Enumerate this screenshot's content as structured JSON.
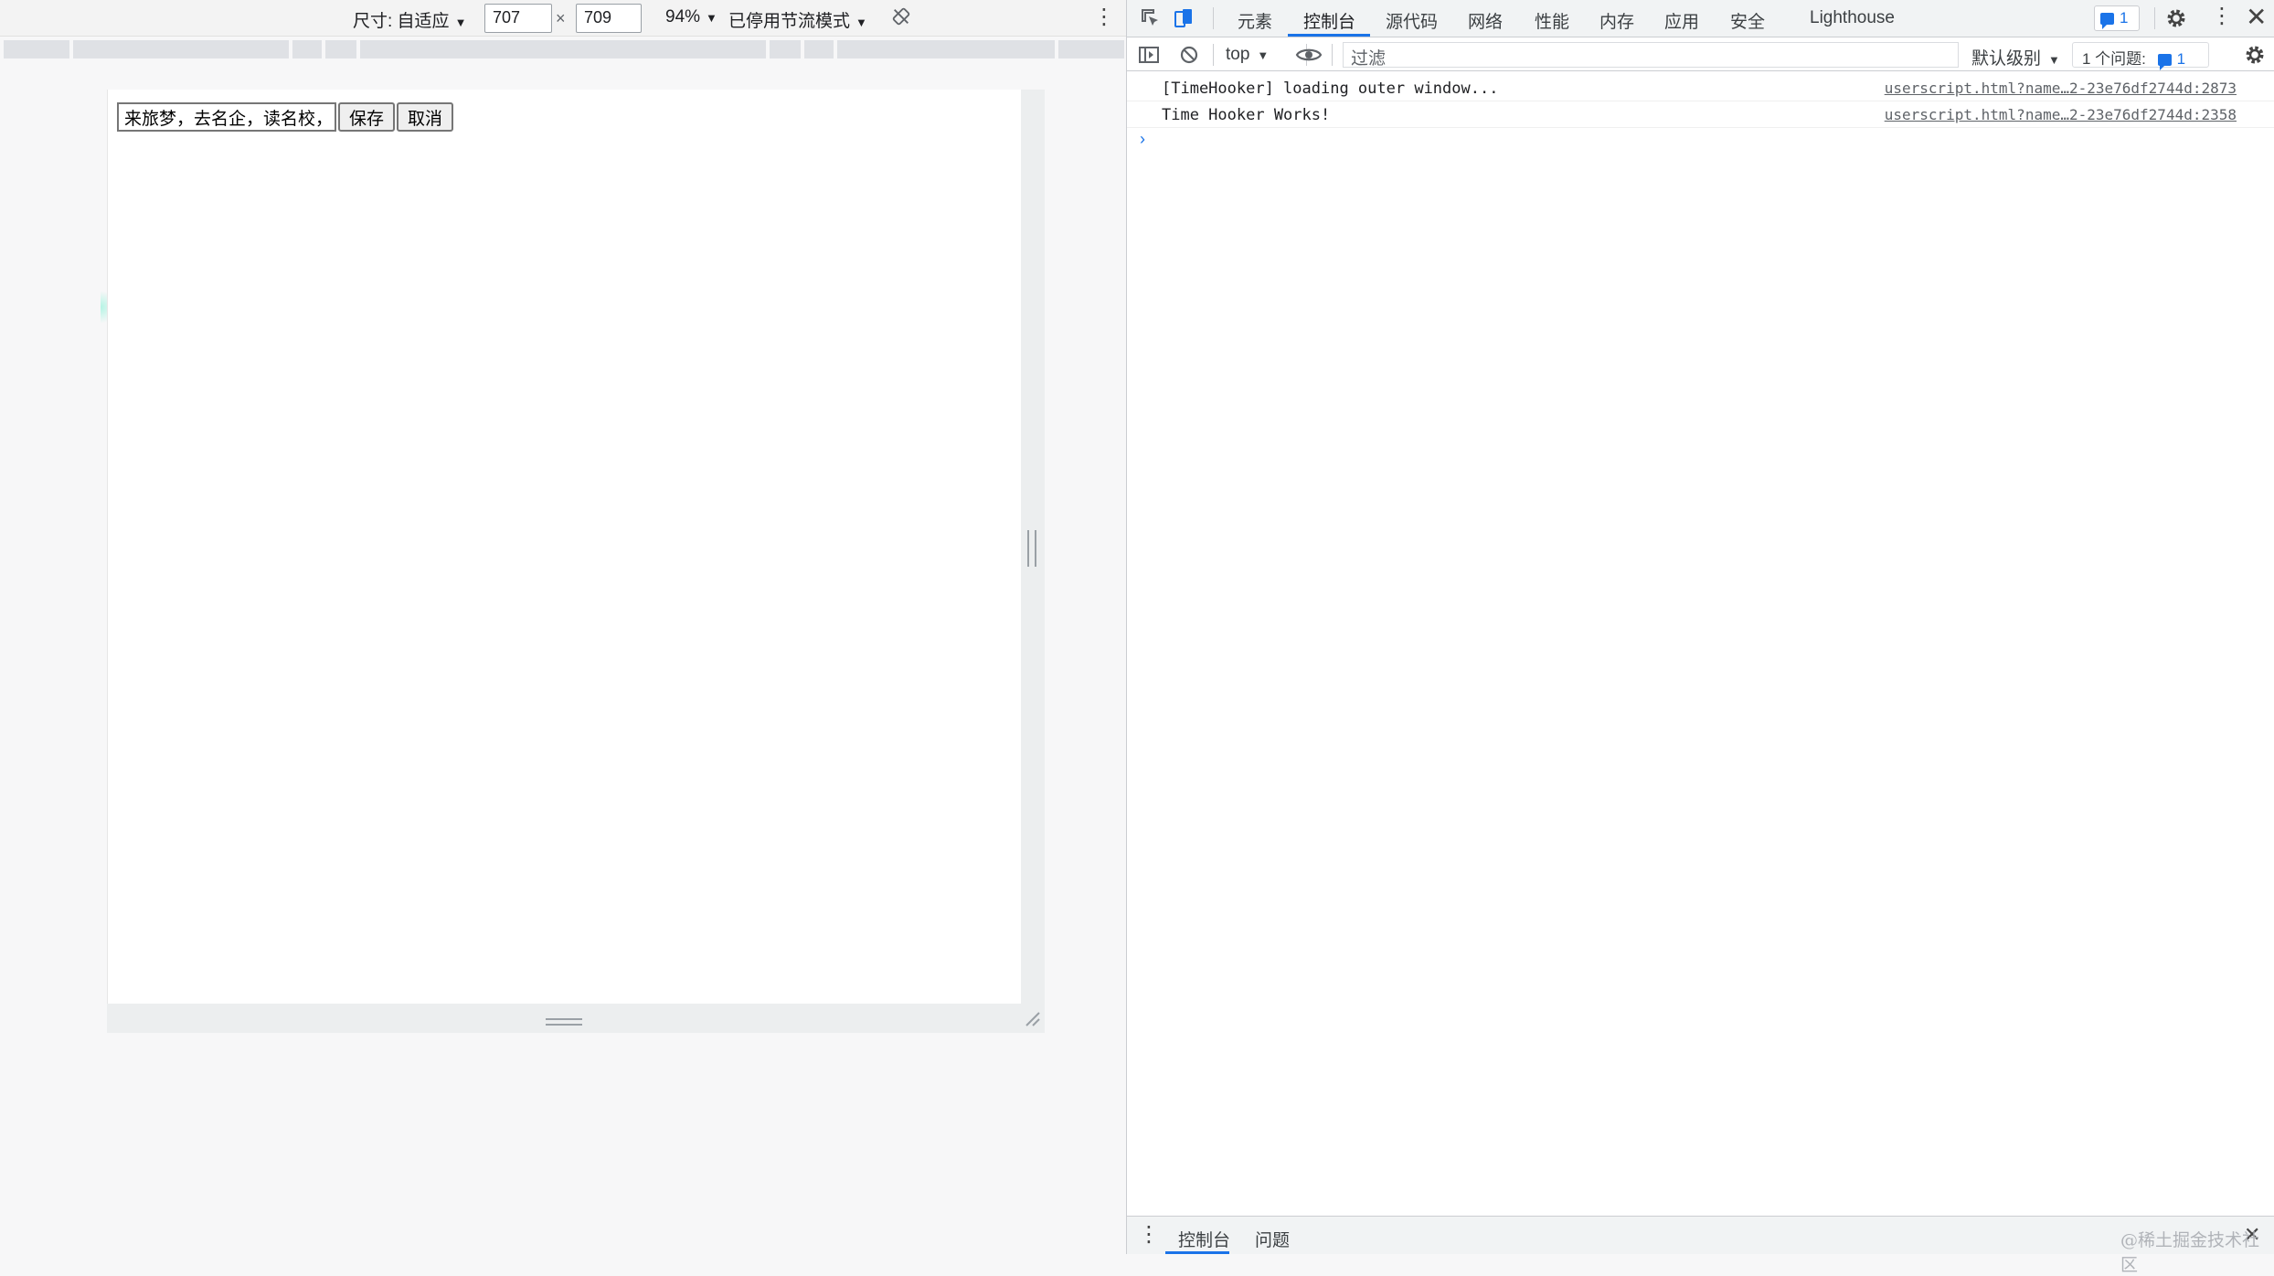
{
  "device_toolbar": {
    "dimensions_label": "尺寸: 自适应",
    "width": "707",
    "times": "×",
    "height": "709",
    "zoom": "94%",
    "throttle": "已停用节流模式",
    "caret": "▼",
    "more": "⋮"
  },
  "page": {
    "input_value": "来旅梦，去名企，读名校，i",
    "save_label": "保存",
    "cancel_label": "取消"
  },
  "devtools": {
    "tabs": [
      "元素",
      "控制台",
      "源代码",
      "网络",
      "性能",
      "内存",
      "应用",
      "安全",
      "Lighthouse"
    ],
    "message_count": "1",
    "context": "top",
    "filter_placeholder": "过滤",
    "level": "默认级别",
    "issues_label": "1 个问题:",
    "issues_count": "1",
    "logs": [
      {
        "message": "[TimeHooker] loading outer window...",
        "source": "userscript.html?name…2-23e76df2744d:2873"
      },
      {
        "message": "Time Hooker Works!",
        "source": "userscript.html?name…2-23e76df2744d:2358"
      }
    ],
    "prompt": "›",
    "drawer_tabs": [
      "控制台",
      "问题"
    ],
    "close": "✕"
  },
  "watermark": "@稀土掘金技术社区"
}
